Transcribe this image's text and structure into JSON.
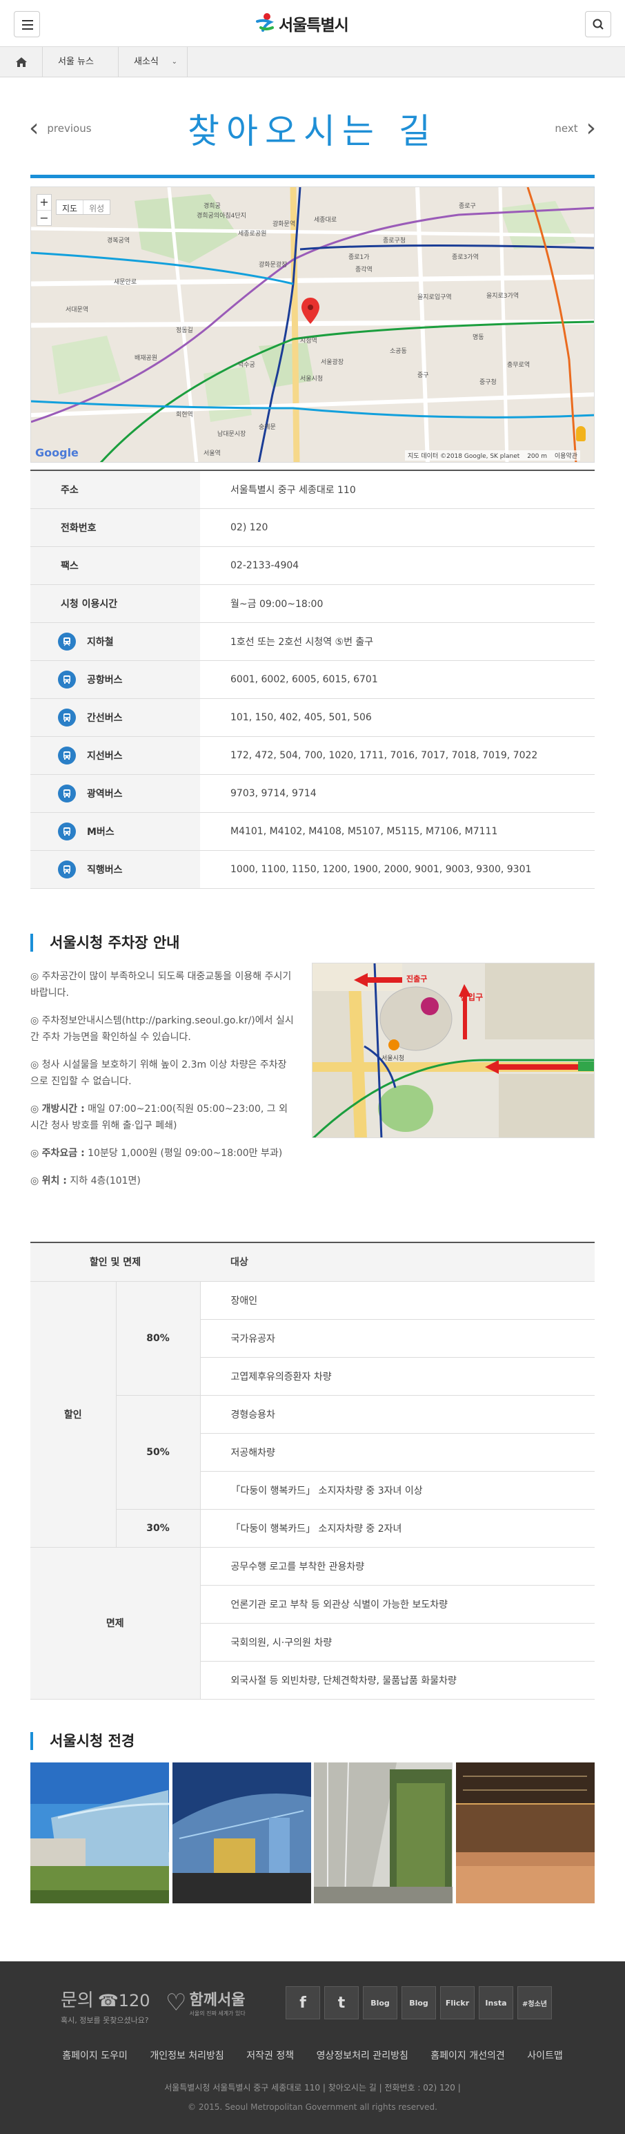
{
  "header": {
    "logo_text": "서울특별시"
  },
  "breadcrumb": {
    "item1": "서울 뉴스",
    "item2": "새소식"
  },
  "nav": {
    "prev": "previous",
    "next": "next"
  },
  "page_title": "찾아오시는 길",
  "map": {
    "type_map": "지도",
    "type_satellite": "위성",
    "zoom_in": "+",
    "zoom_out": "−",
    "attribution": "지도 데이터 ©2018 Google, SK planet",
    "scale": "200 m",
    "terms": "이용약관",
    "google": "Google",
    "labels": [
      "경희궁의아침4단지",
      "경희궁",
      "세종로공원",
      "세종대로",
      "경복궁역",
      "종로구청",
      "광화문역",
      "종로1가",
      "종각역",
      "종로3가역",
      "을지로입구역",
      "시청역",
      "덕수궁",
      "서울시청",
      "서울광장",
      "남대문시장",
      "소공동",
      "명동",
      "회현역",
      "을지로3가역",
      "중구청",
      "충무로역",
      "서울역",
      "숭례문",
      "정동길",
      "배재공원",
      "서대문역",
      "새문안로",
      "광화문광장",
      "종로구",
      "중구"
    ]
  },
  "info": [
    {
      "label": "주소",
      "value": "서울특별시 중구 세종대로 110",
      "icon": null
    },
    {
      "label": "전화번호",
      "value": "02) 120",
      "icon": null
    },
    {
      "label": "팩스",
      "value": "02-2133-4904",
      "icon": null
    },
    {
      "label": "시청 이용시간",
      "value": "월~금 09:00~18:00",
      "icon": null
    },
    {
      "label": "지하철",
      "value": "1호선 또는 2호선 시청역 ⑤번 출구",
      "icon": "subway-icon"
    },
    {
      "label": "공항버스",
      "value": "6001, 6002, 6005, 6015, 6701",
      "icon": "bus-icon"
    },
    {
      "label": "간선버스",
      "value": "101, 150, 402, 405, 501, 506",
      "icon": "bus-icon"
    },
    {
      "label": "지선버스",
      "value": "172, 472, 504, 700, 1020, 1711, 7016, 7017, 7018, 7019, 7022",
      "icon": "bus-icon"
    },
    {
      "label": "광역버스",
      "value": "9703, 9714, 9714",
      "icon": "bus-icon"
    },
    {
      "label": "M버스",
      "value": "M4101, M4102, M4108, M5107, M5115, M7106, M7111",
      "icon": "bus-icon"
    },
    {
      "label": "직행버스",
      "value": "1000, 1100, 1150, 1200, 1900, 2000, 9001, 9003, 9300, 9301",
      "icon": "bus-icon"
    }
  ],
  "parking": {
    "title": "서울시청 주차장 안내",
    "p1": "◎ 주차공간이 많이 부족하오니 되도록 대중교통을 이용해 주시기 바랍니다.",
    "p2": "◎ 주차정보안내시스템(http://parking.seoul.go.kr/)에서 실시간 주차 가능면을 확인하실 수 있습니다.",
    "p3": "◎ 청사 시설물을 보호하기 위해 높이 2.3m 이상 차량은 주차장으로 진입할 수 없습니다.",
    "p4_label": "개방시간 :",
    "p4_value": "매일 07:00~21:00(직원 05:00~23:00, 그 외 시간 청사 방호를 위해 출·입구 폐쇄)",
    "p5_label": "주차요금 :",
    "p5_value": "10분당 1,000원 (평일 09:00~18:00만 부과)",
    "p6_label": "위치 :",
    "p6_value": "지하 4층(101면)",
    "map_entrance": "진입구",
    "map_exit": "진출구",
    "map_cityhall": "서울시청"
  },
  "discount": {
    "head_col1": "할인 및 면제",
    "head_col2": "대상",
    "cat_discount": "할인",
    "cat_exempt": "면제",
    "pct80": "80%",
    "pct50": "50%",
    "pct30": "30%",
    "r80": [
      "장애인",
      "국가유공자",
      "고엽제후유의증환자 차량"
    ],
    "r50": [
      "경형승용차",
      "저공해차량",
      "「다둥이 행복카드」 소지자차량 중 3자녀 이상"
    ],
    "r30": [
      "「다둥이 행복카드」 소지자차량 중 2자녀"
    ],
    "exempt": [
      "공무수행 로고를 부착한 관용차량",
      "언론기관 로고 부착 등 외관상 식별이 가능한 보도차량",
      "국회의원, 시·구의원 차량",
      "외국사절 등 외빈차량, 단체견학차량, 물품납품 화물차량"
    ]
  },
  "view": {
    "title": "서울시청 전경"
  },
  "footer": {
    "contact_label": "문의",
    "contact_number": "☎120",
    "contact_sub": "혹시, 정보를 못찾으셨나요?",
    "brand": "함께서울",
    "brand_sub": "서울의 진짜 세계가 있다",
    "social": [
      "f",
      "t",
      "Blog",
      "Blog",
      "Flickr",
      "Insta",
      "#청소년"
    ],
    "links": [
      "홈페이지 도우미",
      "개인정보 처리방침",
      "저작권 정책",
      "영상정보처리 관리방침",
      "홈페이지 개선의견",
      "사이트맵"
    ],
    "address": "서울특별시청 서울특별시 중구 세종대로 110   |   찾아오시는 길   |   전화번호 : 02) 120   |",
    "copyright": "© 2015. Seoul Metropolitan Government all rights reserved."
  }
}
